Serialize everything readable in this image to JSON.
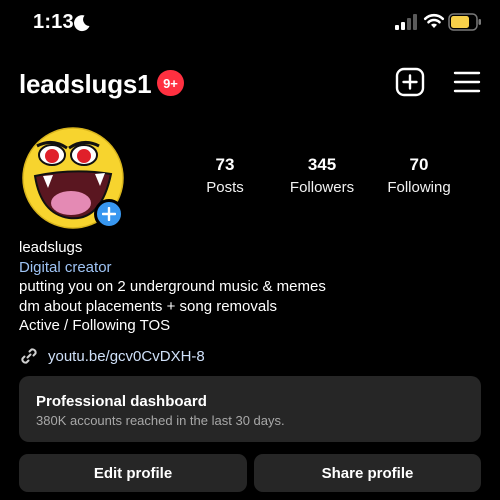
{
  "status_bar": {
    "time": "1:13",
    "icons": [
      "moon-icon",
      "cellular-signal-icon",
      "wifi-icon",
      "battery-icon"
    ],
    "battery_color": "#f7d04a"
  },
  "header": {
    "username": "leadslugs1",
    "notification_badge": "9+",
    "badge_color": "#ff3040",
    "icons": [
      "create-post-icon",
      "hamburger-menu-icon"
    ]
  },
  "stats": {
    "posts": {
      "value": "73",
      "label": "Posts"
    },
    "followers": {
      "value": "345",
      "label": "Followers"
    },
    "following": {
      "value": "70",
      "label": "Following"
    }
  },
  "bio": {
    "name": "leadslugs",
    "category": "Digital creator",
    "lines": [
      "putting you on 2 underground music & memes",
      "dm about placements + song removals",
      "Active / Following TOS"
    ],
    "link": "youtu.be/gcv0CvDXH-8"
  },
  "dashboard": {
    "title": "Professional dashboard",
    "subtitle": "380K accounts reached in the last 30 days."
  },
  "actions": {
    "edit_profile": "Edit profile",
    "share_profile": "Share profile"
  },
  "colors": {
    "background": "#000000",
    "card": "#262626",
    "accent_blue": "#3897f0"
  }
}
